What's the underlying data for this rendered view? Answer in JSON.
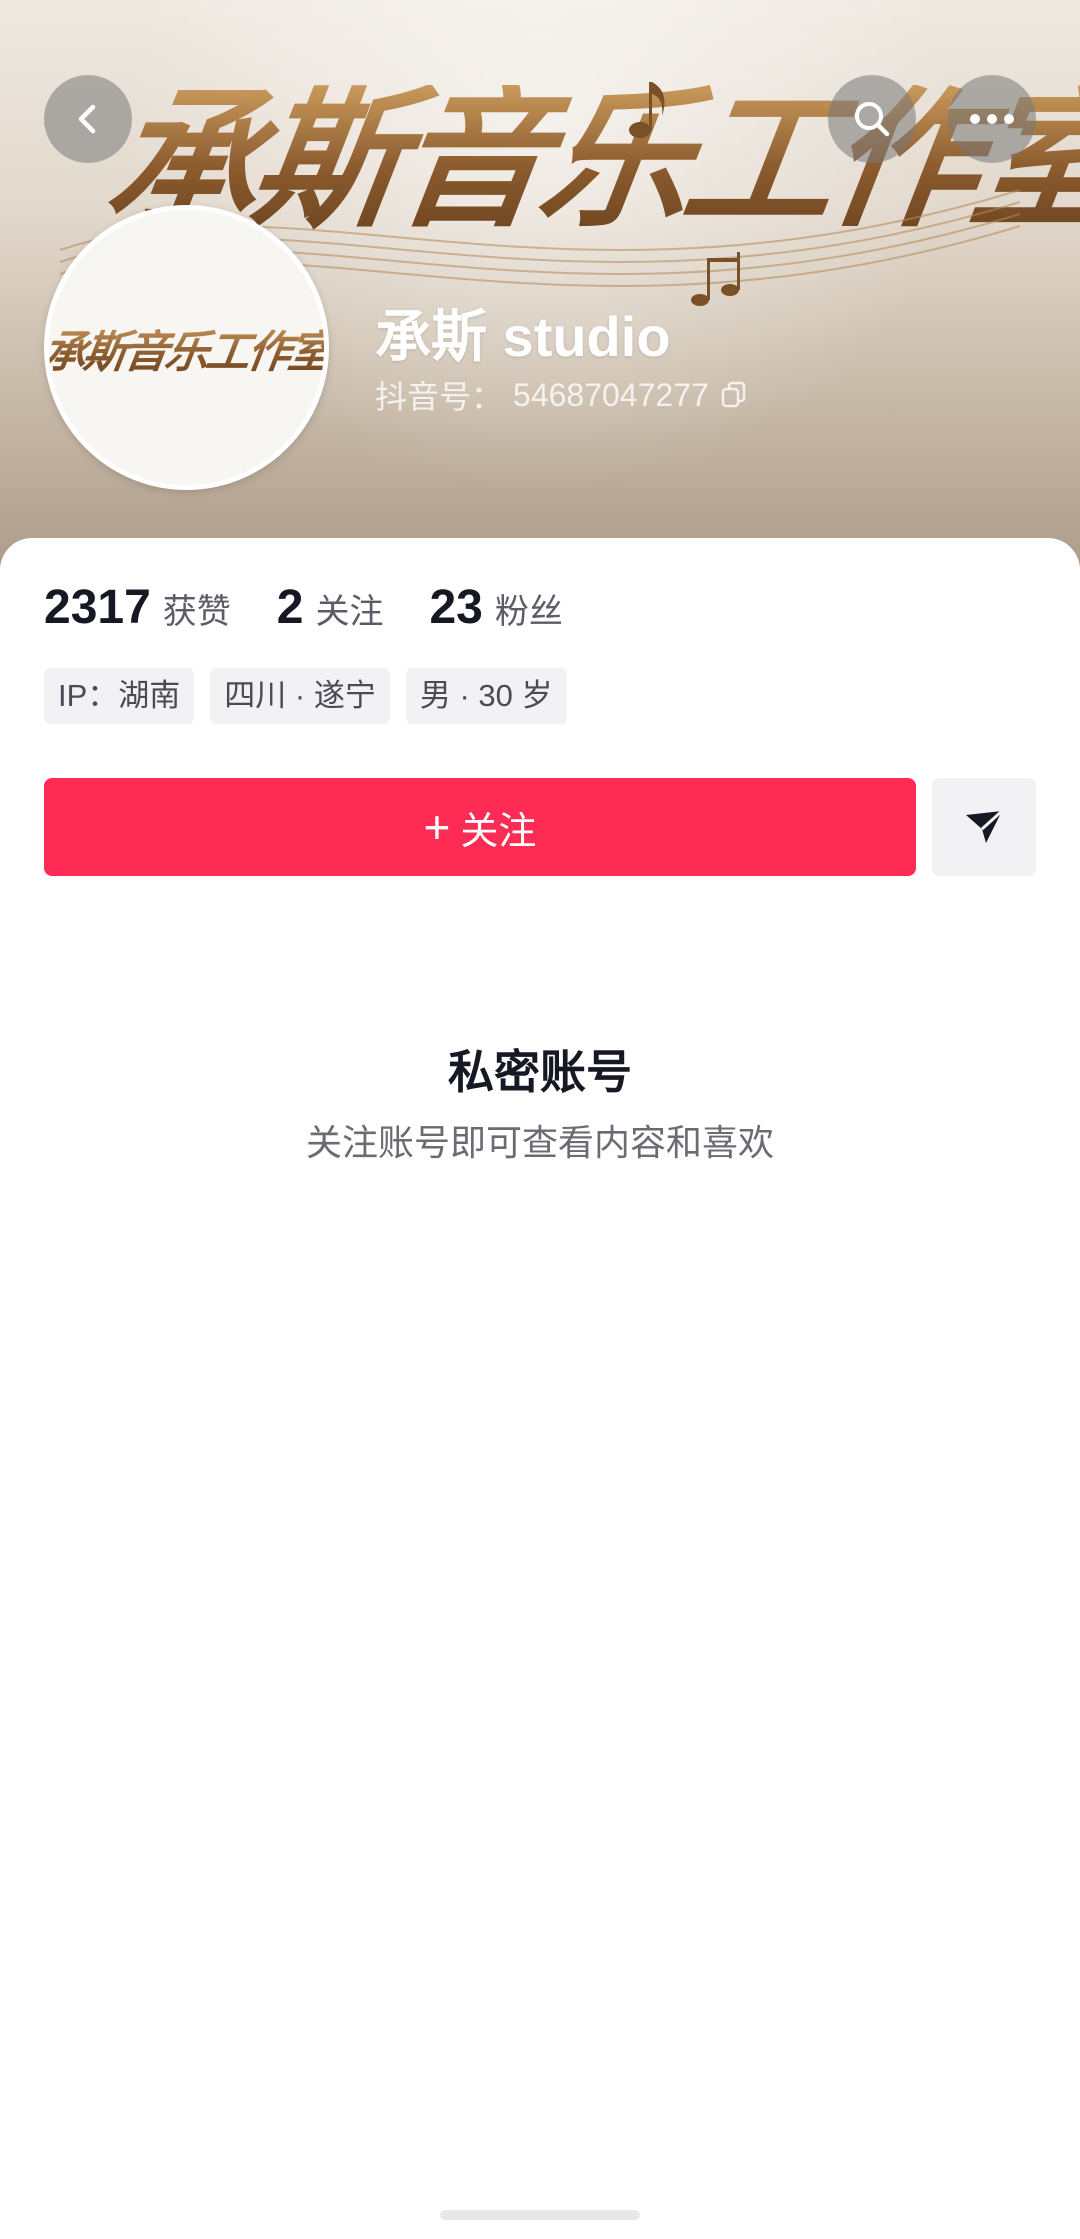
{
  "banner": {
    "calligraphy_text": "承斯音乐工作室"
  },
  "top_bar": {
    "back_icon": "chevron-left-icon",
    "search_icon": "search-icon",
    "more_icon": "more-horizontal-icon"
  },
  "avatar": {
    "logo_text": "承斯音乐工作室"
  },
  "profile": {
    "name": "承斯 studio",
    "account_id_label": "抖音号：",
    "account_id_value": "54687047277",
    "copy_icon": "copy-icon"
  },
  "stats": [
    {
      "value": "2317",
      "label": "获赞"
    },
    {
      "value": "2",
      "label": "关注"
    },
    {
      "value": "23",
      "label": "粉丝"
    }
  ],
  "tags": [
    "IP：湖南",
    "四川 · 遂宁",
    "男 · 30 岁"
  ],
  "actions": {
    "follow_plus": "+",
    "follow_label": "关注",
    "share_icon": "send-icon",
    "follow_color": "#fe2c55"
  },
  "private": {
    "title": "私密账号",
    "description": "关注账号即可查看内容和喜欢"
  }
}
